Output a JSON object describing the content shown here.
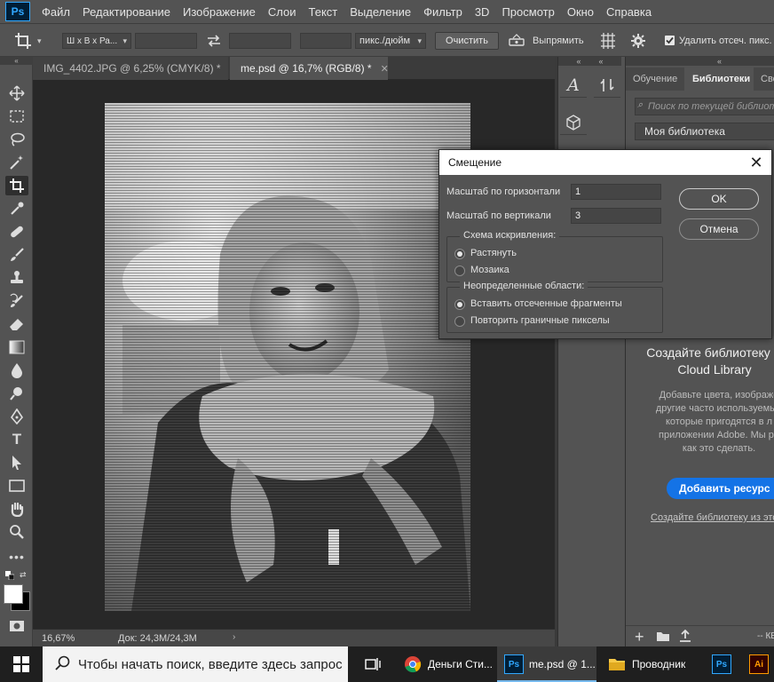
{
  "colors": {
    "ui_bg": "#535353",
    "canvas_bg": "#282828",
    "accent_blue": "#1473e6",
    "ps_blue": "#31a8ff",
    "taskbar": "#1f1f1f"
  },
  "menubar": {
    "logo": "Ps",
    "items": [
      "Файл",
      "Редактирование",
      "Изображение",
      "Слои",
      "Текст",
      "Выделение",
      "Фильтр",
      "3D",
      "Просмотр",
      "Окно",
      "Справка"
    ]
  },
  "options": {
    "ratio_select": "Ш x В x Ра...",
    "units_select": "пикс./дюйм",
    "clear_button": "Очистить",
    "straighten_label": "Выпрямить",
    "delete_cropped_label": "Удалить отсеч. пикс."
  },
  "tabs": [
    {
      "label": "IMG_4402.JPG @ 6,25% (CMYK/8) *",
      "active": false
    },
    {
      "label": "me.psd @ 16,7% (RGB/8) *",
      "active": true
    }
  ],
  "status": {
    "zoom": "16,67%",
    "doc": "Док: 24,3M/24,3M"
  },
  "right_panel": {
    "tabs": [
      "Обучение",
      "Библиотеки",
      "Сво"
    ],
    "search_placeholder": "Поиск по текущей библиот",
    "library_name": "Моя библиотека",
    "title_line1": "Создайте библиотеку C",
    "title_line2": "Cloud Library",
    "desc_lines": [
      "Добавьте цвета, изображе",
      "другие часто используемые",
      "которые пригодятся в л",
      "приложении Adobe. Мы ра",
      "как это сделать."
    ],
    "add_button": "Добавить ресурс",
    "create_link": "Создайте библиотеку из это",
    "footer_text": "-- КБ"
  },
  "dialog": {
    "title": "Смещение",
    "h_label": "Масштаб по горизонтали",
    "h_value": "1",
    "v_label": "Масштаб по вертикали",
    "v_value": "3",
    "distort_group": "Схема искривления:",
    "distort_options": [
      {
        "label": "Растянуть",
        "selected": true
      },
      {
        "label": "Мозаика",
        "selected": false
      }
    ],
    "undefined_group": "Неопределенные области:",
    "undefined_options": [
      {
        "label": "Вставить отсеченные фрагменты",
        "selected": true
      },
      {
        "label": "Повторить граничные пикселы",
        "selected": false
      }
    ],
    "ok_button": "OK",
    "cancel_button": "Отмена"
  },
  "taskbar": {
    "search_placeholder": "Чтобы начать поиск, введите здесь запрос",
    "apps": [
      {
        "label": "Деньги Сти...",
        "icon": "chrome-icon"
      },
      {
        "label": "me.psd @ 1...",
        "icon": "photoshop-icon"
      },
      {
        "label": "Проводник",
        "icon": "explorer-icon"
      }
    ],
    "ps_icon_text": "Ps",
    "ai_icon_text": "Ai"
  }
}
